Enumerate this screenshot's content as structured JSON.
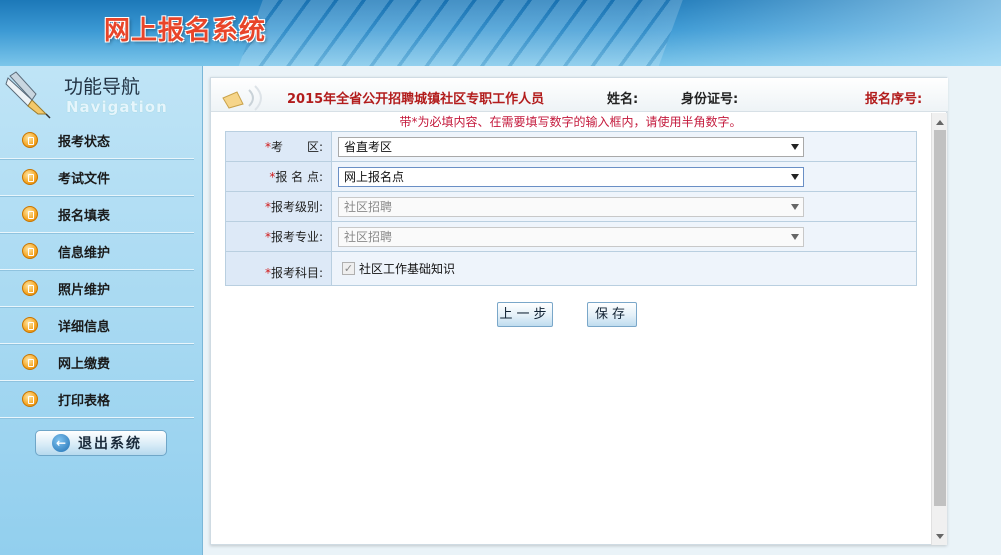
{
  "header": {
    "title": "网上报名系统"
  },
  "sidebar": {
    "title": "功能导航",
    "subtitle": "Navigation",
    "items": [
      {
        "label": "报考状态"
      },
      {
        "label": "考试文件"
      },
      {
        "label": "报名填表"
      },
      {
        "label": "信息维护"
      },
      {
        "label": "照片维护"
      },
      {
        "label": "详细信息"
      },
      {
        "label": "网上缴费"
      },
      {
        "label": "打印表格"
      }
    ],
    "logout_label": "退出系统"
  },
  "topbar": {
    "exam_title": "2015年全省公开招聘城镇社区专职工作人员",
    "name_label": "姓名:",
    "id_label": "身份证号:",
    "serial_label": "报名序号:"
  },
  "notice": "带*为必填内容、在需要填写数字的输入框内，请使用半角数字。",
  "form": {
    "exam_area": {
      "label": "考　　区:",
      "value": "省直考区"
    },
    "reg_point": {
      "label": "报 名 点:",
      "value": "网上报名点"
    },
    "level": {
      "label": "报考级别:",
      "value": "社区招聘"
    },
    "major": {
      "label": "报考专业:",
      "value": "社区招聘"
    },
    "subject": {
      "label": "报考科目:",
      "checkbox_label": "社区工作基础知识"
    },
    "required_mark": "*"
  },
  "buttons": {
    "prev": "上一步",
    "save": "保存"
  },
  "colors": {
    "accent_red": "#b21c1c",
    "sidebar_blue": "#92cfee",
    "banner_blue": "#1c78b8"
  }
}
